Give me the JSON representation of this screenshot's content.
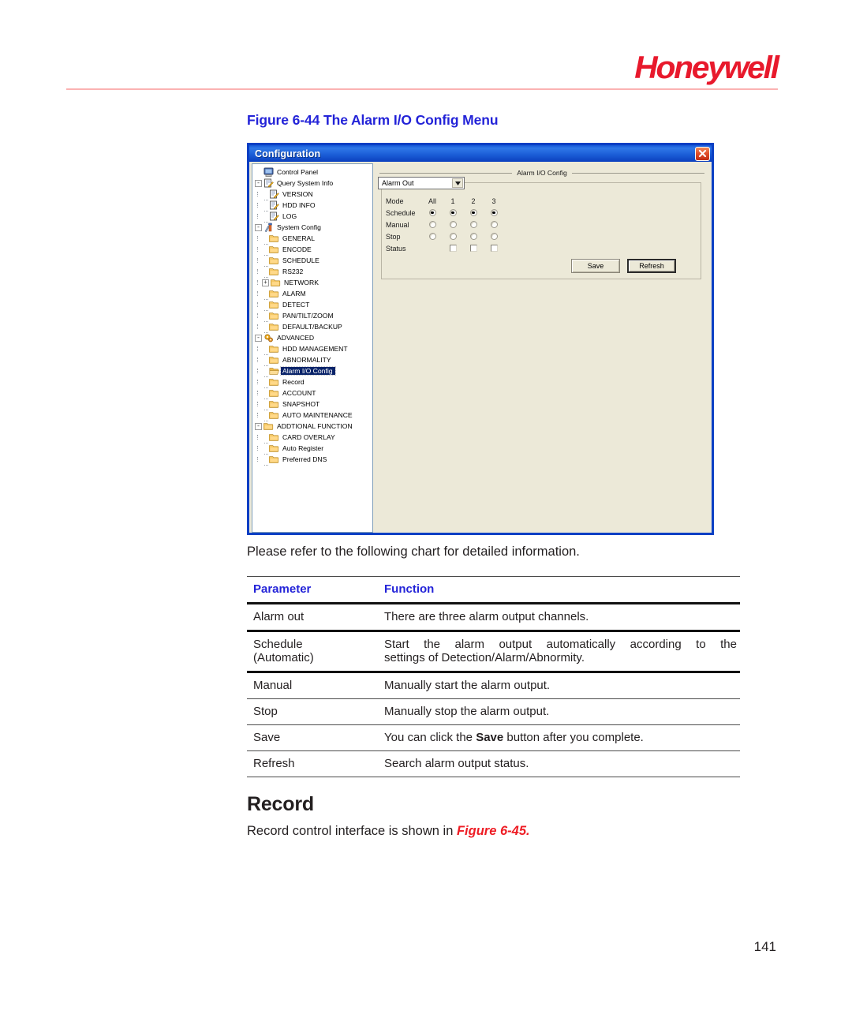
{
  "page": {
    "brand": "Honeywell",
    "number": "141",
    "figure_caption": "Figure 6-44 The Alarm I/O Config Menu",
    "intro_paragraph": "Please refer to the following chart for detailed information.",
    "section_heading": "Record",
    "closing_text_before": "Record control interface is shown in ",
    "closing_text_ref": "Figure 6-45.",
    "colors": {
      "brand_red": "#e8192c",
      "header_rule": "#fbb2b2",
      "caption_blue": "#2323d8",
      "reference_red": "#ee1c24",
      "titlebar_blue": "#0a3fc4"
    }
  },
  "dialog": {
    "title": "Configuration",
    "close_icon": "close-icon",
    "panel_title": "Alarm I/O Config",
    "tree": [
      {
        "label": "Control Panel",
        "depth": 0,
        "icon": "computer-icon",
        "expander": "",
        "selected": false
      },
      {
        "label": "Query System Info",
        "depth": 0,
        "icon": "note-edit-icon",
        "expander": "-",
        "selected": false
      },
      {
        "label": "VERSION",
        "depth": 1,
        "icon": "note-edit-icon",
        "expander": "",
        "selected": false
      },
      {
        "label": "HDD INFO",
        "depth": 1,
        "icon": "note-edit-icon",
        "expander": "",
        "selected": false
      },
      {
        "label": "LOG",
        "depth": 1,
        "icon": "note-edit-icon",
        "expander": "",
        "selected": false
      },
      {
        "label": "System Config",
        "depth": 0,
        "icon": "tools-icon",
        "expander": "-",
        "selected": false
      },
      {
        "label": "GENERAL",
        "depth": 1,
        "icon": "folder-icon",
        "expander": "",
        "selected": false
      },
      {
        "label": "ENCODE",
        "depth": 1,
        "icon": "folder-icon",
        "expander": "",
        "selected": false
      },
      {
        "label": "SCHEDULE",
        "depth": 1,
        "icon": "folder-icon",
        "expander": "",
        "selected": false
      },
      {
        "label": "RS232",
        "depth": 1,
        "icon": "folder-icon",
        "expander": "",
        "selected": false
      },
      {
        "label": "NETWORK",
        "depth": 1,
        "icon": "folder-icon",
        "expander": "+",
        "selected": false
      },
      {
        "label": "ALARM",
        "depth": 1,
        "icon": "folder-icon",
        "expander": "",
        "selected": false
      },
      {
        "label": "DETECT",
        "depth": 1,
        "icon": "folder-icon",
        "expander": "",
        "selected": false
      },
      {
        "label": "PAN/TILT/ZOOM",
        "depth": 1,
        "icon": "folder-icon",
        "expander": "",
        "selected": false
      },
      {
        "label": "DEFAULT/BACKUP",
        "depth": 1,
        "icon": "folder-icon",
        "expander": "",
        "selected": false
      },
      {
        "label": "ADVANCED",
        "depth": 0,
        "icon": "gears-icon",
        "expander": "-",
        "selected": false
      },
      {
        "label": "HDD MANAGEMENT",
        "depth": 1,
        "icon": "folder-icon",
        "expander": "",
        "selected": false
      },
      {
        "label": "ABNORMALITY",
        "depth": 1,
        "icon": "folder-icon",
        "expander": "",
        "selected": false
      },
      {
        "label": "Alarm I/O Config",
        "depth": 1,
        "icon": "folder-open-icon",
        "expander": "",
        "selected": true
      },
      {
        "label": "Record",
        "depth": 1,
        "icon": "folder-icon",
        "expander": "",
        "selected": false
      },
      {
        "label": "ACCOUNT",
        "depth": 1,
        "icon": "folder-icon",
        "expander": "",
        "selected": false
      },
      {
        "label": "SNAPSHOT",
        "depth": 1,
        "icon": "folder-icon",
        "expander": "",
        "selected": false
      },
      {
        "label": "AUTO MAINTENANCE",
        "depth": 1,
        "icon": "folder-icon",
        "expander": "",
        "selected": false
      },
      {
        "label": "ADDTIONAL FUNCTION",
        "depth": 0,
        "icon": "folder-icon",
        "expander": "-",
        "selected": false
      },
      {
        "label": "CARD OVERLAY",
        "depth": 1,
        "icon": "folder-icon",
        "expander": "",
        "selected": false
      },
      {
        "label": "Auto Register",
        "depth": 1,
        "icon": "folder-icon",
        "expander": "",
        "selected": false
      },
      {
        "label": "Preferred DNS",
        "depth": 1,
        "icon": "folder-icon",
        "expander": "",
        "selected": false
      }
    ],
    "alarm_out": {
      "combo_value": "Alarm Out",
      "column_headers": [
        "All",
        "1",
        "2",
        "3"
      ],
      "mode_label": "Mode",
      "rows": [
        {
          "label": "Schedule",
          "type": "radio",
          "states": [
            true,
            true,
            true,
            true
          ]
        },
        {
          "label": "Manual",
          "type": "radio",
          "states": [
            false,
            false,
            false,
            false
          ]
        },
        {
          "label": "Stop",
          "type": "radio",
          "states": [
            false,
            false,
            false,
            false
          ]
        },
        {
          "label": "Status",
          "type": "checkbox",
          "states": [
            null,
            false,
            false,
            false
          ]
        }
      ],
      "save_label": "Save",
      "refresh_label": "Refresh"
    }
  },
  "table": {
    "headers": [
      "Parameter",
      "Function"
    ],
    "rows": [
      {
        "parameter": "Alarm out",
        "function": "There are three alarm output channels.",
        "function2": ""
      },
      {
        "parameter": "Schedule\n(Automatic)",
        "function": "Start the alarm output automatically according to the",
        "function2": "settings of Detection/Alarm/Abnormity."
      },
      {
        "parameter": "Manual",
        "function": "Manually start the alarm output.",
        "function2": ""
      },
      {
        "parameter": "Stop",
        "function": "Manually stop the alarm output.",
        "function2": ""
      },
      {
        "parameter": "Save",
        "function_pre": "You can click the ",
        "function_bold": "Save",
        "function_post": " button after you complete.",
        "function": "",
        "function2": ""
      },
      {
        "parameter": "Refresh",
        "function": "Search alarm output status.",
        "function2": ""
      }
    ]
  }
}
